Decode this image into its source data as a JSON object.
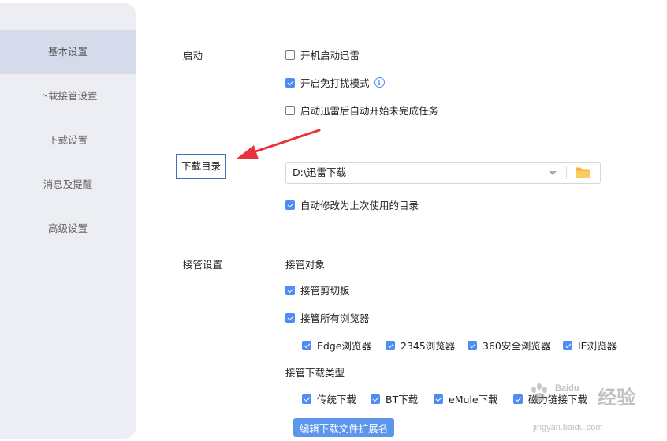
{
  "sidebar": {
    "items": [
      {
        "label": "基本设置",
        "active": true
      },
      {
        "label": "下载接管设置",
        "active": false
      },
      {
        "label": "下载设置",
        "active": false
      },
      {
        "label": "消息及提醒",
        "active": false
      },
      {
        "label": "高级设置",
        "active": false
      }
    ]
  },
  "startup": {
    "label": "启动",
    "options": [
      {
        "label": "开机启动迅雷",
        "checked": false
      },
      {
        "label": "开启免打扰模式",
        "checked": true
      },
      {
        "label": "启动迅雷后自动开始未完成任务",
        "checked": false
      }
    ]
  },
  "download_dir": {
    "label": "下载目录",
    "path": "D:\\迅雷下载",
    "auto_modify": {
      "label": "自动修改为上次使用的目录",
      "checked": true
    }
  },
  "takeover": {
    "label": "接管设置",
    "targets_title": "接管对象",
    "clipboard": {
      "label": "接管剪切板",
      "checked": true
    },
    "all_browsers": {
      "label": "接管所有浏览器",
      "checked": true
    },
    "browsers": [
      {
        "label": "Edge浏览器",
        "checked": true
      },
      {
        "label": "2345浏览器",
        "checked": true
      },
      {
        "label": "360安全浏览器",
        "checked": true
      },
      {
        "label": "IE浏览器",
        "checked": true
      }
    ],
    "types_title": "接管下载类型",
    "types": [
      {
        "label": "传统下载",
        "checked": true
      },
      {
        "label": "BT下载",
        "checked": true
      },
      {
        "label": "eMule下载",
        "checked": true
      },
      {
        "label": "磁力链接下载",
        "checked": true
      }
    ],
    "edit_ext_button": "编辑下载文件扩展名"
  },
  "watermark": {
    "brand": "Baidu",
    "main": "经验",
    "url": "jingyan.baidu.com"
  },
  "colors": {
    "accent": "#4f8df2",
    "annotation_arrow": "#e8333c",
    "sidebar_bg": "#eceef3",
    "sidebar_active": "#d5dbea"
  }
}
